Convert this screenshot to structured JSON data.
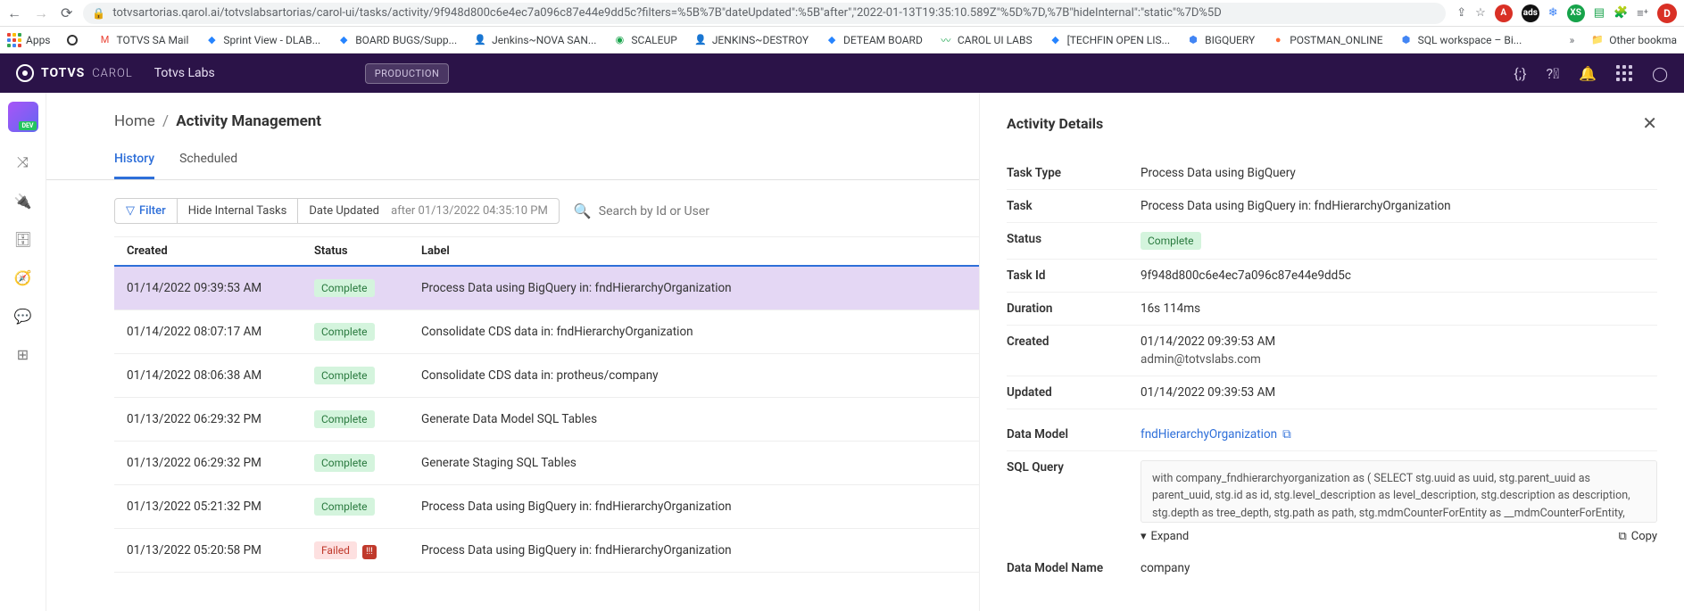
{
  "browser": {
    "url": "totvsartorias.qarol.ai/totvslabsartorias/carol-ui/tasks/activity/9f948d800c6e4ec7a096c87e44e9dd5c?filters=%5B%7B\"dateUpdated\":%5B\"after\",\"2022-01-13T19:35:10.589Z\"%5D%7D,%7B\"hideInternal\":\"static\"%7D%5D",
    "avatar_letter": "D"
  },
  "bookmarks": {
    "items": [
      {
        "label": "Apps"
      },
      {
        "label": ""
      },
      {
        "label": "TOTVS SA Mail"
      },
      {
        "label": "Sprint View - DLAB..."
      },
      {
        "label": "BOARD BUGS/Supp..."
      },
      {
        "label": "Jenkins~NOVA SAN..."
      },
      {
        "label": "SCALEUP"
      },
      {
        "label": "JENKINS~DESTROY"
      },
      {
        "label": "DETEAM BOARD"
      },
      {
        "label": "CAROL UI LABS"
      },
      {
        "label": "[TECHFIN OPEN LIS..."
      },
      {
        "label": "BIGQUERY"
      },
      {
        "label": "POSTMAN_ONLINE"
      },
      {
        "label": "SQL workspace – Bi..."
      }
    ],
    "other": "Other bookma"
  },
  "header": {
    "brand": "TOTVS",
    "brand_sub": "CAROL",
    "lab": "Totvs Labs",
    "env_badge": "PRODUCTION"
  },
  "breadcrumb": {
    "home": "Home",
    "current": "Activity Management"
  },
  "tabs": {
    "history": "History",
    "scheduled": "Scheduled"
  },
  "filters": {
    "filter_label": "Filter",
    "hide_internal": "Hide Internal Tasks",
    "date_key": "Date Updated",
    "date_val": "after 01/13/2022 04:35:10 PM",
    "search_placeholder": "Search by Id or User"
  },
  "table": {
    "headers": {
      "created": "Created",
      "status": "Status",
      "label": "Label"
    },
    "rows": [
      {
        "created": "01/14/2022 09:39:53 AM",
        "status": "Complete",
        "status_class": "complete",
        "label": "Process Data using BigQuery in: fndHierarchyOrganization",
        "selected": true
      },
      {
        "created": "01/14/2022 08:07:17 AM",
        "status": "Complete",
        "status_class": "complete",
        "label": "Consolidate CDS data in: fndHierarchyOrganization"
      },
      {
        "created": "01/14/2022 08:06:38 AM",
        "status": "Complete",
        "status_class": "complete",
        "label": "Consolidate CDS data in: protheus/company"
      },
      {
        "created": "01/13/2022 06:29:32 PM",
        "status": "Complete",
        "status_class": "complete",
        "label": "Generate Data Model SQL Tables"
      },
      {
        "created": "01/13/2022 06:29:32 PM",
        "status": "Complete",
        "status_class": "complete",
        "label": "Generate Staging SQL Tables"
      },
      {
        "created": "01/13/2022 05:21:32 PM",
        "status": "Complete",
        "status_class": "complete",
        "label": "Process Data using BigQuery in: fndHierarchyOrganization"
      },
      {
        "created": "01/13/2022 05:20:58 PM",
        "status": "Failed",
        "status_class": "failed",
        "label": "Process Data using BigQuery in: fndHierarchyOrganization",
        "warn": true
      }
    ]
  },
  "details": {
    "title": "Activity Details",
    "fields": {
      "task_type_k": "Task Type",
      "task_type_v": "Process Data using BigQuery",
      "task_k": "Task",
      "task_v": "Process Data using BigQuery in: fndHierarchyOrganization",
      "status_k": "Status",
      "status_v": "Complete",
      "taskid_k": "Task Id",
      "taskid_v": "9f948d800c6e4ec7a096c87e44e9dd5c",
      "duration_k": "Duration",
      "duration_v": "16s 114ms",
      "created_k": "Created",
      "created_v": "01/14/2022 09:39:53 AM",
      "created_sub": "admin@totvslabs.com",
      "updated_k": "Updated",
      "updated_v": "01/14/2022 09:39:53 AM",
      "dm_k": "Data Model",
      "dm_v": "fndHierarchyOrganization",
      "sql_k": "SQL Query",
      "sql_v": "with company_fndhierarchyorganization as ( SELECT stg.uuid as uuid, stg.parent_uuid as parent_uuid, stg.id as id, stg.level_description as level_description, stg.description as description, stg.depth as tree_depth, stg.path as path, stg.mdmCounterForEntity as __mdmCounterForEntity, stg.mdmid as __mdmId, from `carol-",
      "expand": "Expand",
      "copy": "Copy",
      "dmname_k": "Data Model Name",
      "dmname_v": "company"
    }
  }
}
